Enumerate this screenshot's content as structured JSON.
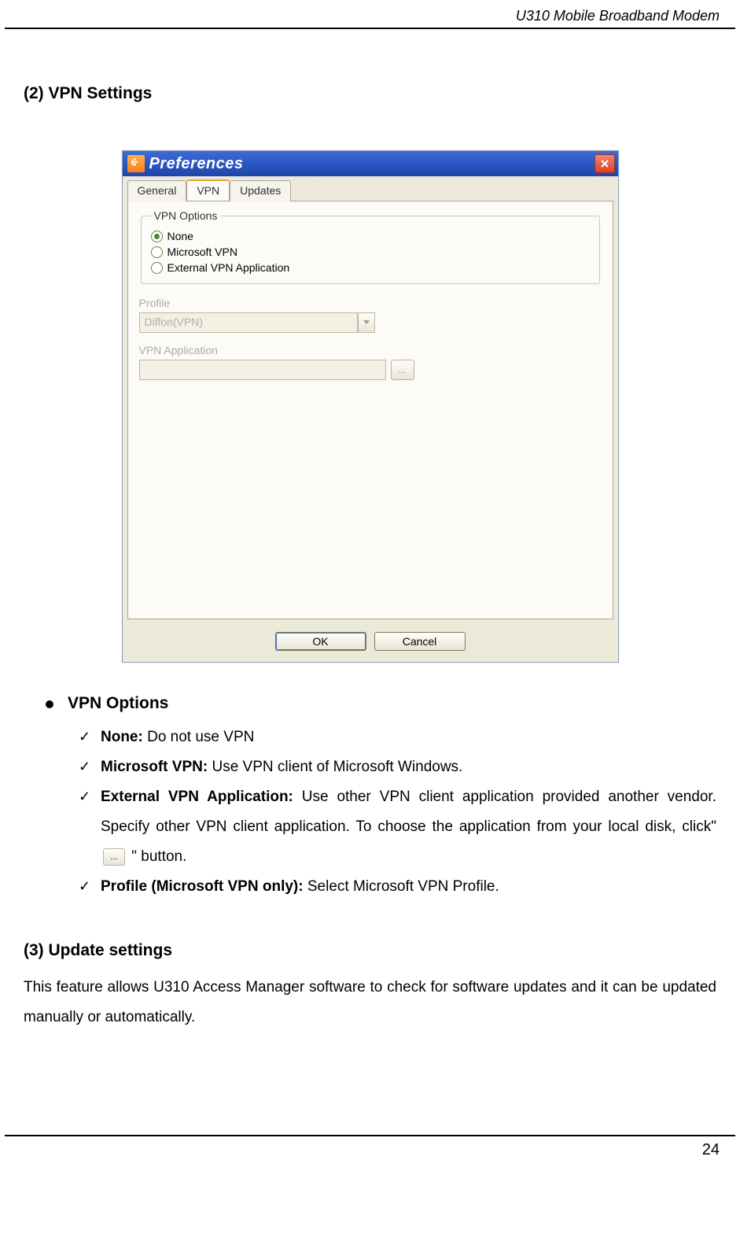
{
  "header": {
    "title": "U310 Mobile Broadband Modem"
  },
  "section2": {
    "heading": "(2) VPN Settings"
  },
  "dialog": {
    "title": "Preferences",
    "tabs": {
      "general": "General",
      "vpn": "VPN",
      "updates": "Updates"
    },
    "groupbox": {
      "legend": "VPN Options",
      "opt_none": "None",
      "opt_ms": "Microsoft VPN",
      "opt_ext": "External VPN Application"
    },
    "profile_label": "Profile",
    "profile_value": "Diffon(VPN)",
    "vpnapp_label": "VPN Application",
    "vpnapp_value": "",
    "browse_dots": "...",
    "ok": "OK",
    "cancel": "Cancel"
  },
  "bullets": {
    "title": "VPN Options",
    "none_b": "None:",
    "none_t": " Do not use VPN",
    "ms_b": "Microsoft VPN:",
    "ms_t": " Use VPN client of Microsoft Windows.",
    "ext_b": "External VPN Application:",
    "ext_t1": " Use other VPN client application provided another vendor. Specify other VPN client application. To choose the application from your local disk, click\" ",
    "ext_t2": " \" button.",
    "prof_b": "Profile (Microsoft VPN only):",
    "prof_t": " Select Microsoft VPN Profile."
  },
  "section3": {
    "heading": "(3) Update settings",
    "para": "This feature allows U310 Access Manager software to check for software updates and it can be updated manually or automatically."
  },
  "footer": {
    "page": "24"
  }
}
